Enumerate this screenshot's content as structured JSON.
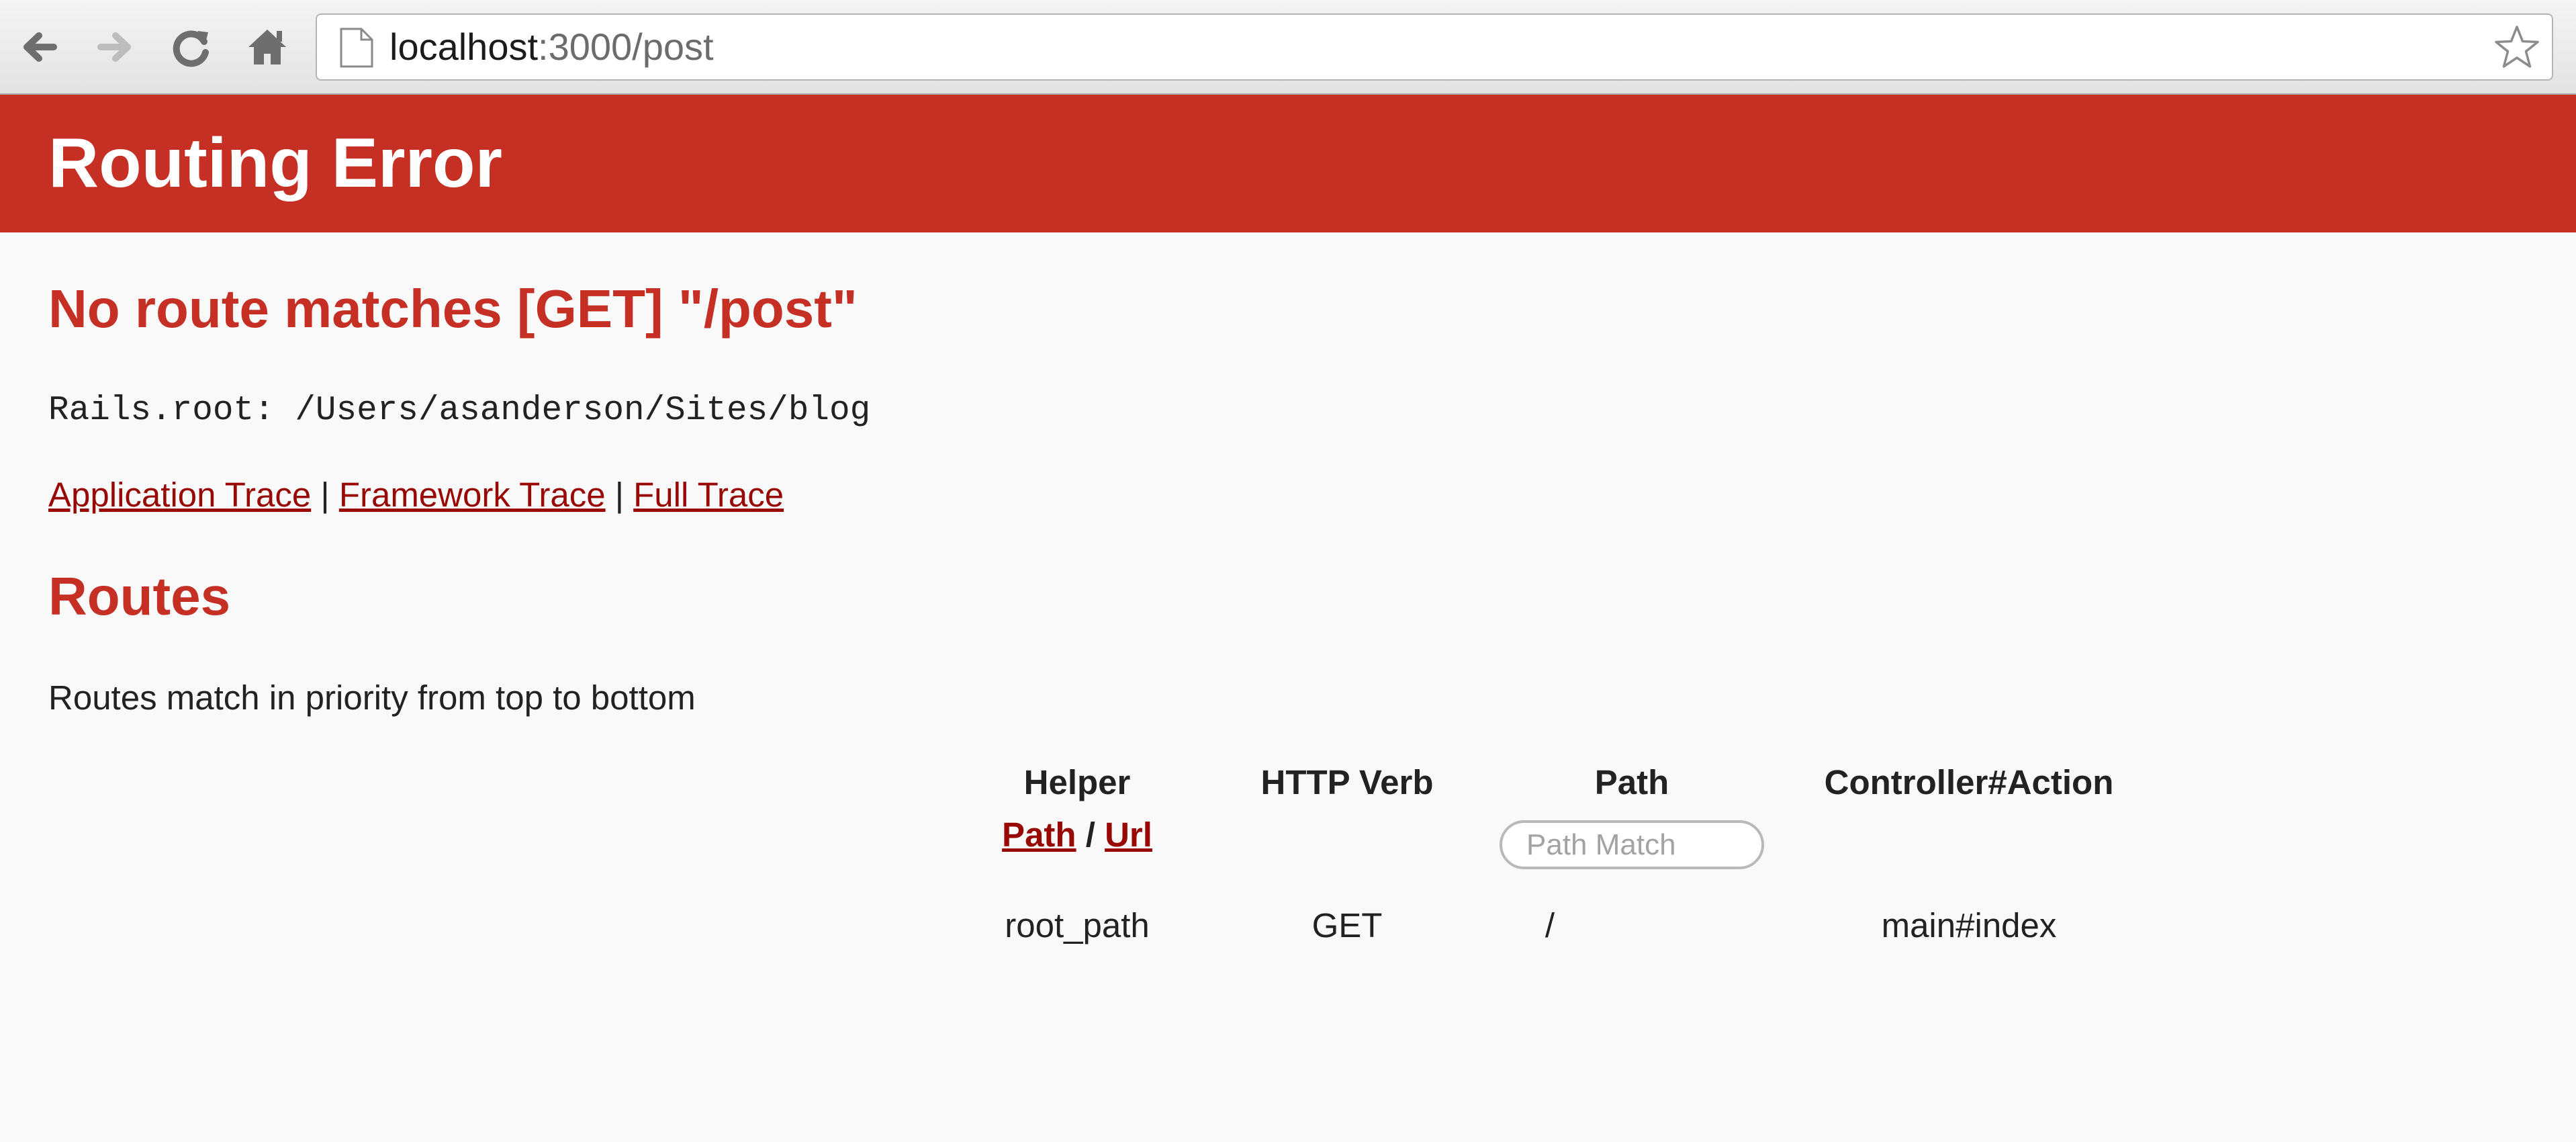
{
  "browser": {
    "url_host": "localhost",
    "url_rest": ":3000/post",
    "icons": [
      "back-arrow-icon",
      "forward-arrow-icon",
      "reload-icon",
      "home-icon",
      "page-icon",
      "bookmark-star-icon"
    ]
  },
  "page": {
    "header_title": "Routing Error",
    "error_message": "No route matches [GET] \"/post\"",
    "rails_root": "Rails.root: /Users/asanderson/Sites/blog",
    "trace_links": {
      "application": "Application Trace",
      "framework": "Framework Trace",
      "full": "Full Trace",
      "separator": "|"
    },
    "routes_heading": "Routes",
    "routes_description": "Routes match in priority from top to bottom"
  },
  "routes_table": {
    "headers": {
      "helper": "Helper",
      "verb": "HTTP Verb",
      "path": "Path",
      "action": "Controller#Action"
    },
    "helper_toggle": {
      "path": "Path",
      "slash": "/",
      "url": "Url"
    },
    "path_filter_placeholder": "Path Match",
    "rows": [
      {
        "helper": "root_path",
        "verb": "GET",
        "path": "/",
        "action": "main#index"
      }
    ]
  },
  "colors": {
    "brand_red": "#c52f24",
    "link_red": "#980905",
    "page_background": "#f9f9f9"
  }
}
